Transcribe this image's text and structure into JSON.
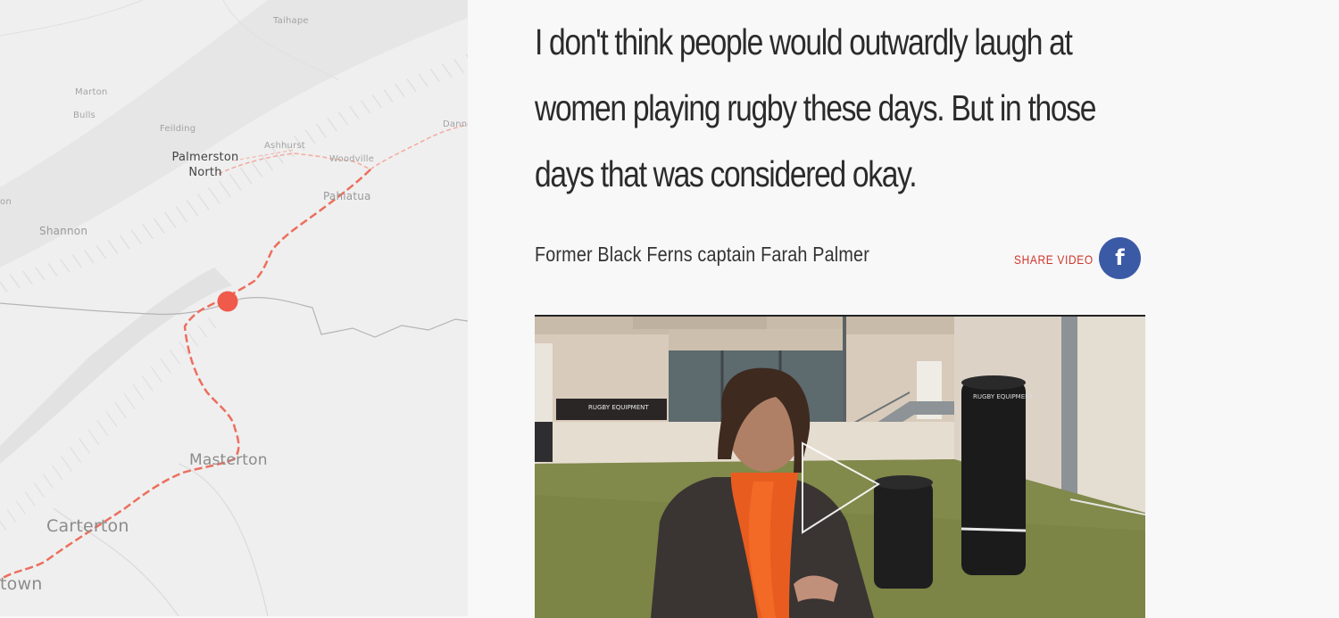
{
  "map": {
    "places": {
      "taihape": "Taihape",
      "marton": "Marton",
      "bulls": "Bulls",
      "feilding": "Feilding",
      "ashhurst": "Ashhurst",
      "dannevirke": "Danne",
      "palmerston_north": "Palmerston North",
      "woodville": "Woodville",
      "pahiatua": "Pahiatua",
      "shannon": "Shannon",
      "foxton": "on",
      "masterton": "Masterton",
      "carterton": "Carterton",
      "greytown": "town"
    },
    "route_color": "#f08070",
    "marker_color": "#f05a4a"
  },
  "quote": {
    "text": "I don't think people would outwardly laugh at women playing rugby these days. But in those days that was considered okay.",
    "attribution": "Former Black Ferns captain Farah Palmer"
  },
  "share": {
    "label": "SHARE VIDEO",
    "facebook_icon": "f",
    "facebook_color": "#3b5aa6"
  },
  "video": {
    "banner_text": "RUGBY EQUIPMENT",
    "pad_text": "RUGBY EQUIPMENT"
  }
}
